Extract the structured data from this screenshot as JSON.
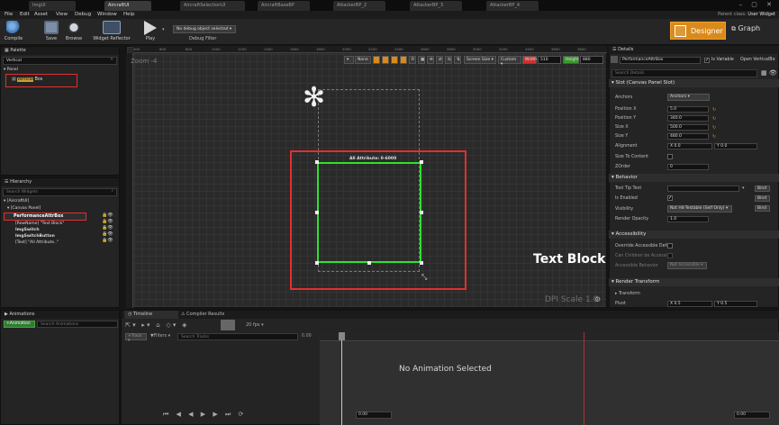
{
  "tabs": [
    {
      "label": "ImgUI",
      "active": false
    },
    {
      "label": "AircraftUI",
      "active": true
    },
    {
      "label": "AircraftSelectionUI",
      "active": false
    },
    {
      "label": "AircraftBaseBP",
      "active": false
    },
    {
      "label": "AttackerBP_2",
      "active": false
    },
    {
      "label": "AttackerBP_3",
      "active": false
    },
    {
      "label": "AttackerBP_4",
      "active": false
    }
  ],
  "menu": [
    "File",
    "Edit",
    "Asset",
    "View",
    "Debug",
    "Window",
    "Help"
  ],
  "parent_class": {
    "label": "Parent class:",
    "value": "User Widget"
  },
  "toolbar": {
    "compile": "Compile",
    "save": "Save",
    "browse": "Browse",
    "widget_reflector": "Widget Reflector",
    "play": "Play",
    "debug_select": "No debug object selected",
    "debug_filter": "Debug Filter"
  },
  "mode": {
    "designer": "Designer",
    "graph": "Graph"
  },
  "palette": {
    "title": "Palette",
    "search_value": "Vertical",
    "category": "Panel",
    "item_prefix": "Vertical",
    "item_suffix": " Box"
  },
  "hierarchy": {
    "title": "Hierarchy",
    "search_placeholder": "Search Widgets",
    "rows": [
      "[AircraftUI]",
      "[Canvas Panel]",
      "PerformanceAttrBox",
      "[RowName] \"Text Block\"",
      "ImgSwitch",
      "ImgSwitchButton",
      "[Text] \"All Attribute..\""
    ]
  },
  "viewport": {
    "zoom": "Zoom -4",
    "none_label": "None",
    "grid_letter": "R",
    "screen_size": "Screen Size",
    "custom": "Custom",
    "width_label": "Width",
    "width_value": "510",
    "height_label": "Height",
    "height_value": "880",
    "widget_label": "All Attribute: 0-6000",
    "text_block": "Text Block",
    "dpi_scale": "DPI Scale 1.0",
    "ruler_ticks": [
      "400",
      "600",
      "800",
      "1000",
      "1200",
      "1400",
      "1600",
      "1800",
      "2000",
      "2200",
      "2400",
      "2600",
      "2800",
      "3000",
      "3200",
      "3400",
      "3600",
      "3800"
    ]
  },
  "details": {
    "title": "Details",
    "name": "PerformanceAttrBox",
    "is_variable": "Is Variable",
    "open_link": "Open VerticalBo",
    "search_placeholder": "Search Details",
    "slot_section": "Slot (Canvas Panel Slot)",
    "anchors_label": "Anchors",
    "anchors_value": "Anchors",
    "position_x_label": "Position X",
    "position_x": "5.0",
    "position_y_label": "Position Y",
    "position_y": "340.0",
    "size_x_label": "Size X",
    "size_x": "500.0",
    "size_y_label": "Size Y",
    "size_y": "480.0",
    "alignment_label": "Alignment",
    "alignment_x": "X 0.0",
    "alignment_y": "Y 0.0",
    "size_to_content_label": "Size To Content",
    "zorder_label": "ZOrder",
    "zorder": "0",
    "behavior_section": "Behavior",
    "tooltip_label": "Tool Tip Text",
    "is_enabled_label": "Is Enabled",
    "visibility_label": "Visibility",
    "visibility_value": "Not Hit-Testable (Self Only)",
    "render_opacity_label": "Render Opacity",
    "render_opacity": "1.0",
    "accessibility_section": "Accessibility",
    "override_label": "Override Accessible Defa",
    "can_children_label": "Can Children be Accessi",
    "accessible_behavior_label": "Accessible Behavior",
    "accessible_behavior_value": "Not Accessible",
    "render_transform_section": "Render Transform",
    "transform_label": "Transform",
    "pivot_label": "Pivot",
    "pivot_x": "X 0.5",
    "pivot_y": "Y 0.5",
    "bind": "Bind"
  },
  "animations": {
    "title": "Animations",
    "add_button": "+Animation",
    "search_placeholder": "Search Animations"
  },
  "timeline": {
    "tab_timeline": "Timeline",
    "tab_compiler": "Compiler Results",
    "fps": "20 fps",
    "track_btn": "Track",
    "filters": "Filters",
    "search_placeholder": "Search Tracks",
    "time_value": "0.00",
    "empty_message": "No Animation Selected",
    "right_time": "0.00"
  },
  "colors": {
    "accent_orange": "#d98a1a",
    "selection_red": "#e03030",
    "widget_green": "#30e030",
    "palette_highlight": "#c8a030"
  }
}
